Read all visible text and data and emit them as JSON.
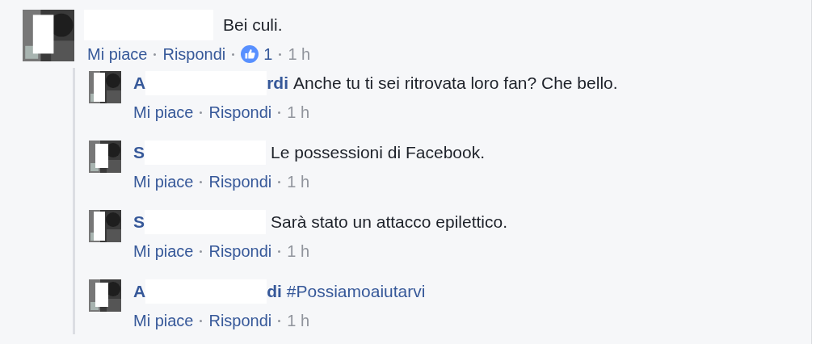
{
  "comment": {
    "text": "Bei culi.",
    "actions": [
      "Mi piace",
      "Rispondi"
    ],
    "likes": "1",
    "time": "1 h"
  },
  "replies": [
    {
      "name_start": "A",
      "name_end": "rdi",
      "text": "Anche tu ti sei ritrovata loro fan? Che bello.",
      "kind": "plain",
      "actions": [
        "Mi piace",
        "Rispondi"
      ],
      "time": "1 h"
    },
    {
      "name_start": "S",
      "text": "Le possessioni di Facebook.",
      "kind": "plain",
      "actions": [
        "Mi piace",
        "Rispondi"
      ],
      "time": "1 h"
    },
    {
      "name_start": "S",
      "text": "Sarà stato un attacco epilettico.",
      "kind": "plain",
      "actions": [
        "Mi piace",
        "Rispondi"
      ],
      "time": "1 h"
    },
    {
      "name_start": "A",
      "name_end": "di",
      "text": "#Possiamoaiutarvi",
      "kind": "hashtag",
      "actions": [
        "Mi piace",
        "Rispondi"
      ],
      "time": "1 h"
    }
  ]
}
